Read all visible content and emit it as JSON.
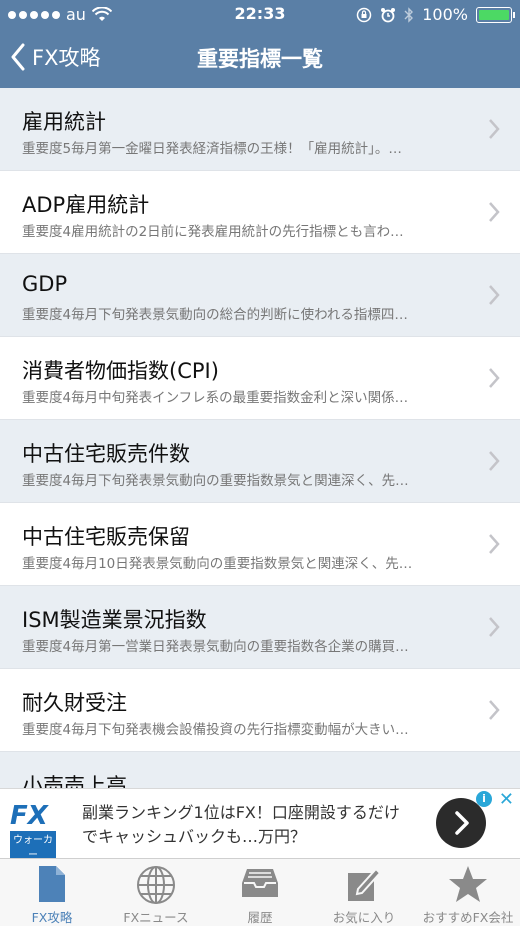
{
  "status_bar": {
    "carrier": "au",
    "time": "22:33",
    "battery": "100%",
    "battery_level": 1.0
  },
  "nav": {
    "back_label": "FX攻略",
    "title": "重要指標一覧"
  },
  "list": [
    {
      "title": "雇用統計",
      "desc": "重要度5毎月第一金曜日発表経済指標の王様！「雇用統計」。…"
    },
    {
      "title": "ADP雇用統計",
      "desc": "重要度4雇用統計の2日前に発表雇用統計の先行指標とも言わ…"
    },
    {
      "title": "GDP",
      "desc": "重要度4毎月下旬発表景気動向の総合的判断に使われる指標四…"
    },
    {
      "title": "消費者物価指数(CPI)",
      "desc": "重要度4毎月中旬発表インフレ系の最重要指数金利と深い関係…"
    },
    {
      "title": "中古住宅販売件数",
      "desc": "重要度4毎月下旬発表景気動向の重要指数景気と関連深く、先…"
    },
    {
      "title": "中古住宅販売保留",
      "desc": "重要度4毎月10日発表景気動向の重要指数景気と関連深く、先…"
    },
    {
      "title": "ISM製造業景況指数",
      "desc": "重要度4毎月第一営業日発表景気動向の重要指数各企業の購買…"
    },
    {
      "title": "耐久財受注",
      "desc": "重要度4毎月下旬発表機会設備投資の先行指標変動幅が大きい…"
    },
    {
      "title": "小売売上高",
      "desc": ""
    }
  ],
  "ad": {
    "logo_main": "FX",
    "logo_sub": "ウォーカー",
    "text": "副業ランキング1位はFX！口座開設するだけでキャッシュバックも…万円？",
    "info": "i",
    "close": "✕"
  },
  "tabs": [
    {
      "label": "FX攻略",
      "icon": "document-icon",
      "active": true
    },
    {
      "label": "FXニュース",
      "icon": "globe-icon",
      "active": false
    },
    {
      "label": "履歴",
      "icon": "inbox-tray-icon",
      "active": false
    },
    {
      "label": "お気に入り",
      "icon": "edit-pencil-icon",
      "active": false
    },
    {
      "label": "おすすめFX会社",
      "icon": "star-icon",
      "active": false
    }
  ],
  "colors": {
    "nav_bg": "#5a7fa6",
    "alt_row": "#e9eef3",
    "active_tab": "#4d82b8",
    "inactive_tab": "#8a8a8a",
    "battery": "#4cd964"
  }
}
